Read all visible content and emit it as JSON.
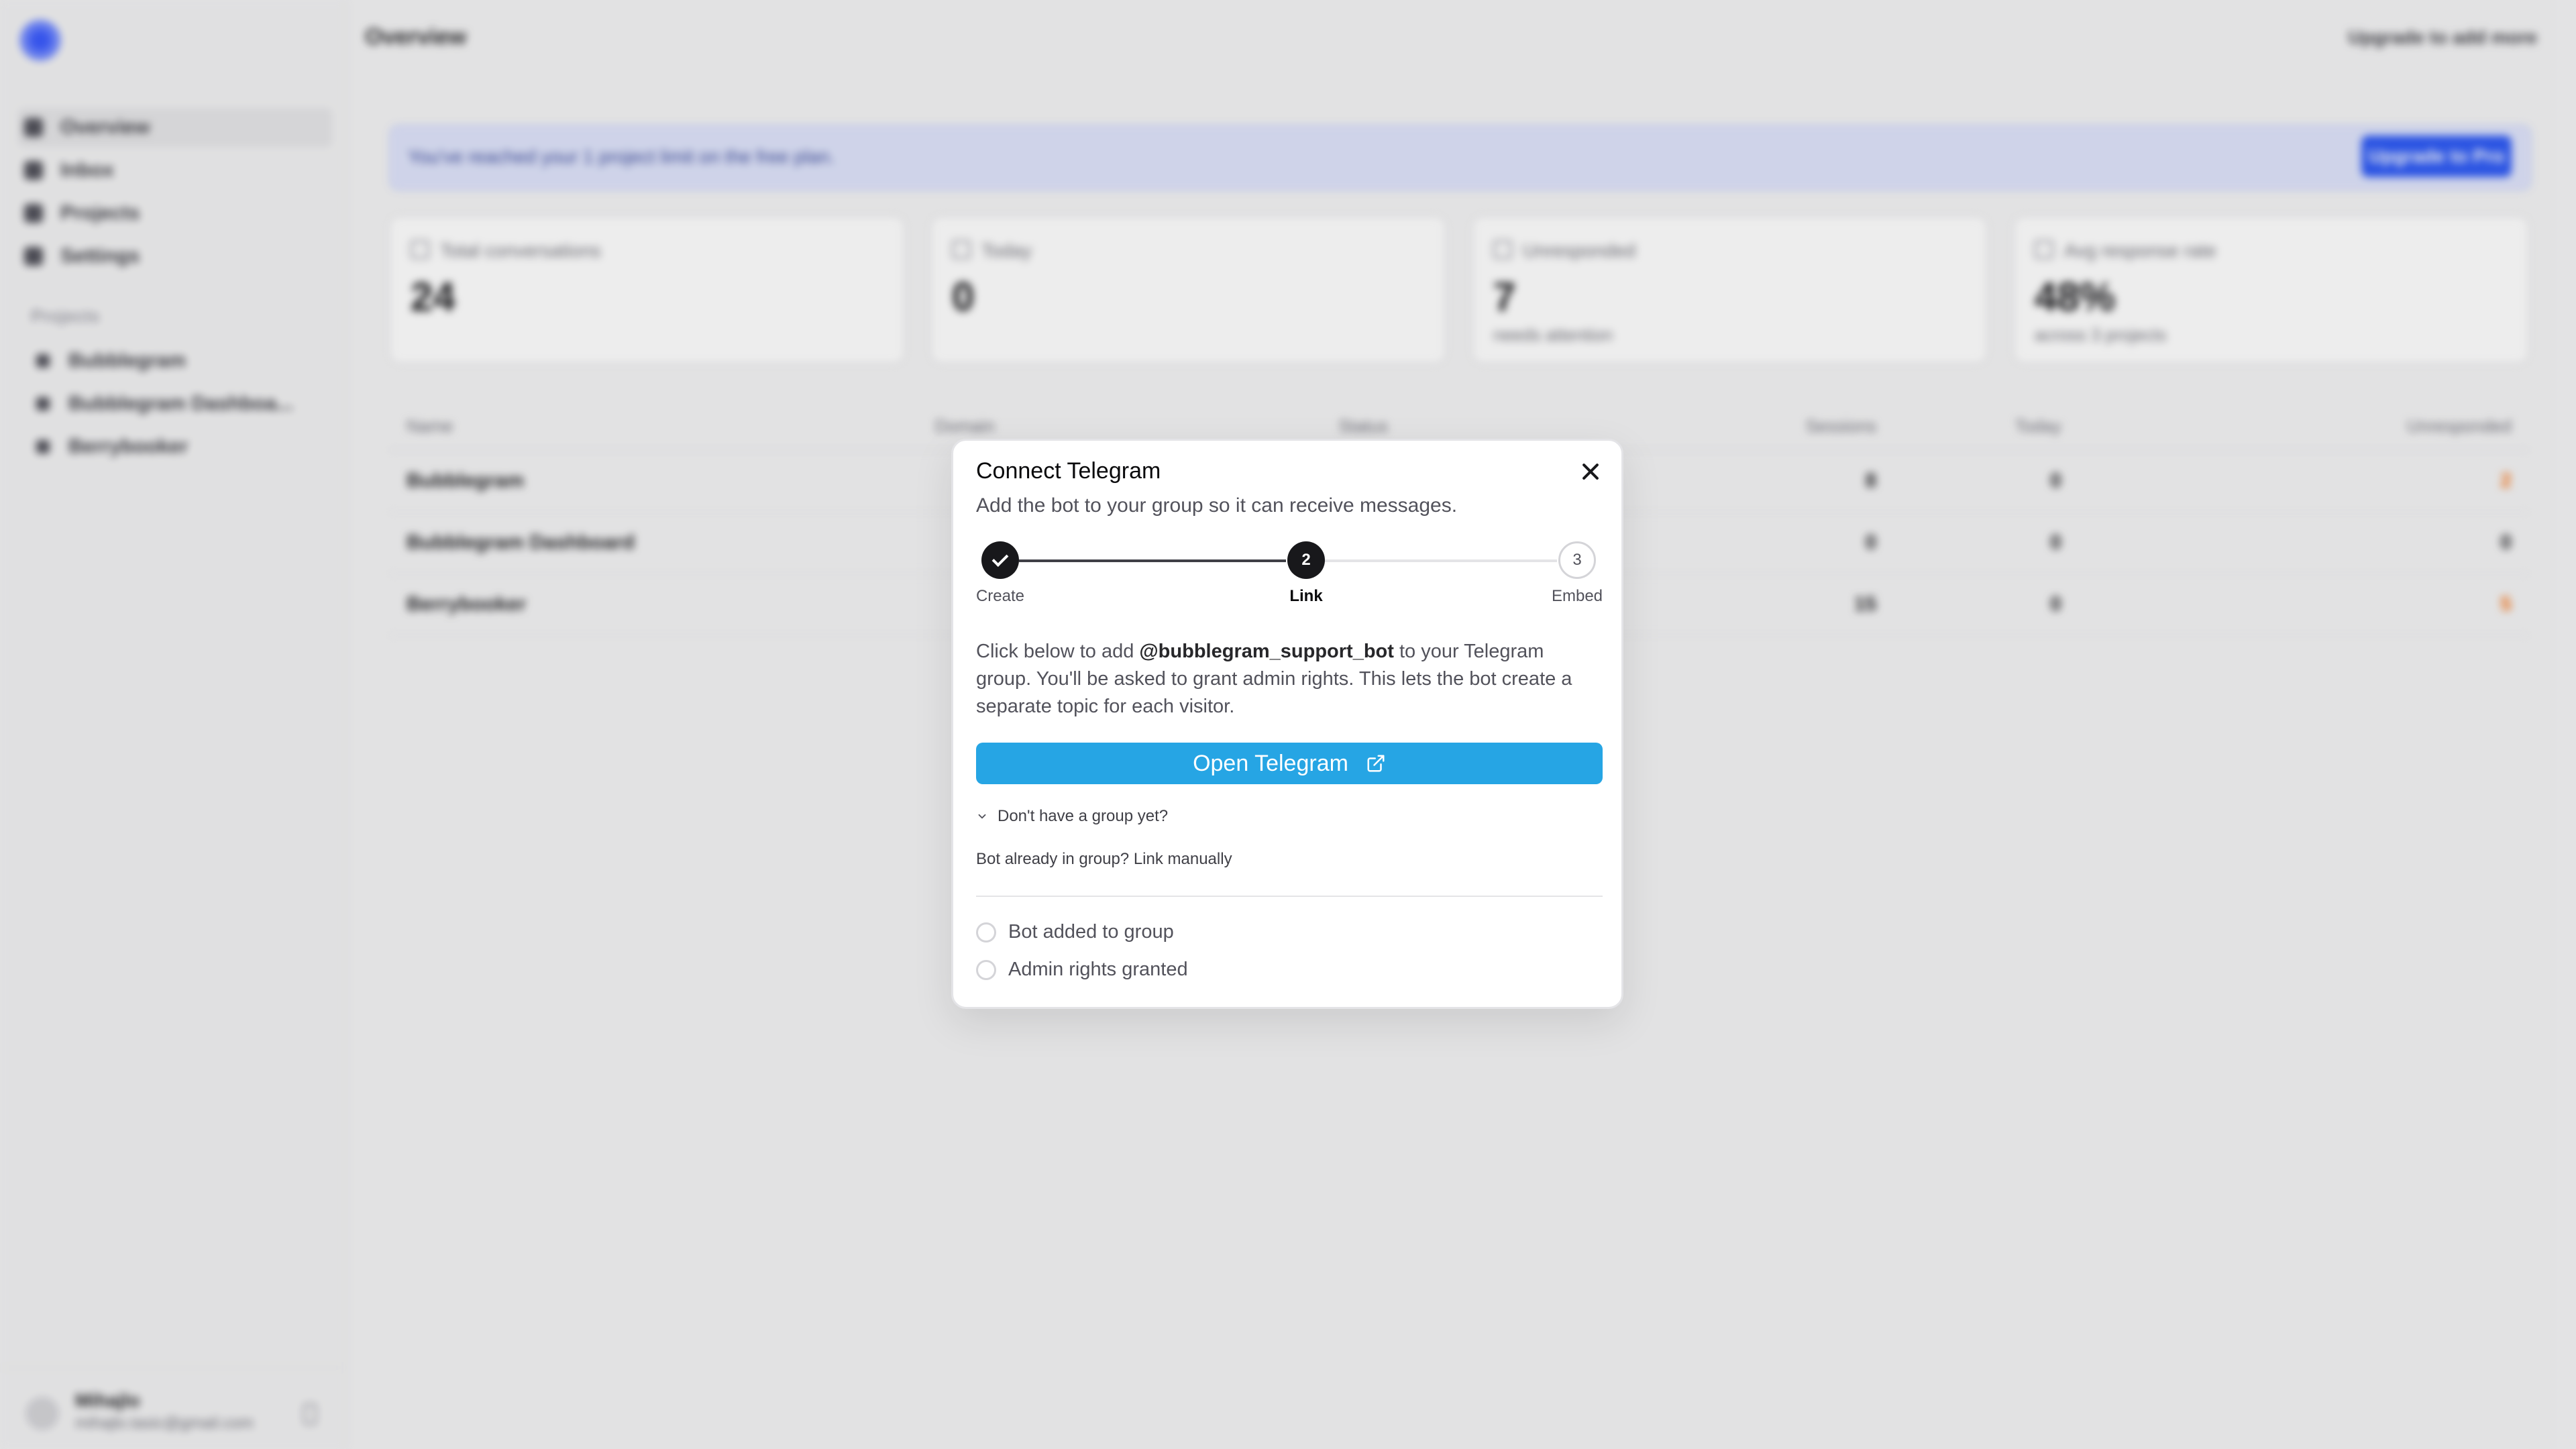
{
  "sidebar": {
    "nav": [
      {
        "label": "Overview"
      },
      {
        "label": "Inbox"
      },
      {
        "label": "Projects"
      },
      {
        "label": "Settings"
      }
    ],
    "projects_heading": "Projects",
    "projects": [
      {
        "label": "Bubblegram"
      },
      {
        "label": "Bubblegram Dashboa..."
      },
      {
        "label": "Berrybooker"
      }
    ],
    "user": {
      "name": "Mihajlo",
      "email": "mihajlo.tasic@gmail.com"
    }
  },
  "header": {
    "title": "Overview",
    "upgrade_link": "Upgrade to add more"
  },
  "banner": {
    "text": "You've reached your 1 project limit on the free plan.",
    "button": "Upgrade to Pro"
  },
  "stats": [
    {
      "label": "Total conversations",
      "value": "24",
      "sub": ""
    },
    {
      "label": "Today",
      "value": "0",
      "sub": ""
    },
    {
      "label": "Unresponded",
      "value": "7",
      "sub": "needs attention"
    },
    {
      "label": "Avg response rate",
      "value": "48%",
      "sub": "across 3 projects"
    }
  ],
  "table": {
    "headers": {
      "name": "Name",
      "domain": "Domain",
      "status": "Status",
      "sessions": "Sessions",
      "today": "Today",
      "unresponded": "Unresponded"
    },
    "rows": [
      {
        "name": "Bubblegram",
        "sessions": "8",
        "today": "0",
        "unresponded": "2"
      },
      {
        "name": "Bubblegram Dashboard",
        "sessions": "0",
        "today": "0",
        "unresponded": "0"
      },
      {
        "name": "Berrybooker",
        "sessions": "15",
        "today": "0",
        "unresponded": "5"
      }
    ]
  },
  "dialog": {
    "title": "Connect Telegram",
    "description": "Add the bot to your group so it can receive messages.",
    "steps": [
      {
        "number": "1",
        "label": "Create",
        "state": "done"
      },
      {
        "number": "2",
        "label": "Link",
        "state": "current"
      },
      {
        "number": "3",
        "label": "Embed",
        "state": "todo"
      }
    ],
    "body_prefix": "Click below to add ",
    "bot_handle": "@bubblegram_support_bot",
    "body_suffix": " to your Telegram group. You'll be asked to grant admin rights. This lets the bot create a separate topic for each visitor.",
    "open_button": "Open Telegram",
    "no_group_toggle": "Don't have a group yet?",
    "manual_link": "Bot already in group? Link manually",
    "checklist": [
      {
        "label": "Bot added to group"
      },
      {
        "label": "Admin rights granted"
      }
    ]
  },
  "colors": {
    "telegram_blue": "#26a5e4",
    "accent": "#2f5bf5",
    "warning": "#f97316",
    "ink": "#18181b"
  }
}
